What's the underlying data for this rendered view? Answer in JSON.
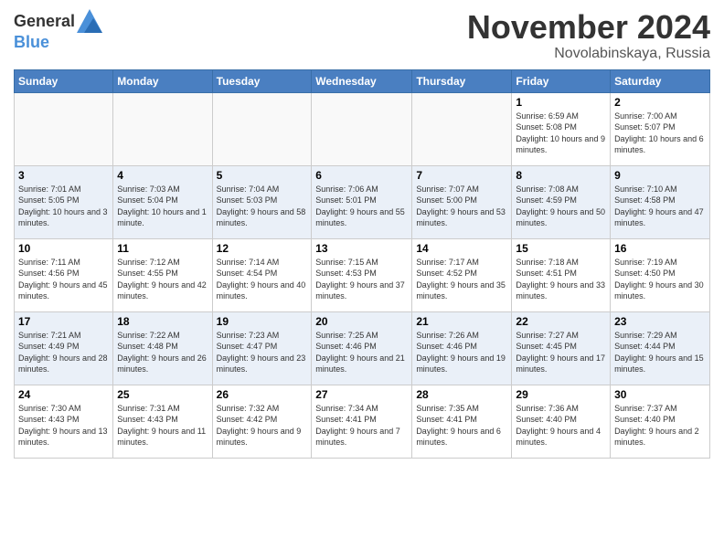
{
  "header": {
    "logo_general": "General",
    "logo_blue": "Blue",
    "month_title": "November 2024",
    "location": "Novolabinskaya, Russia"
  },
  "weekdays": [
    "Sunday",
    "Monday",
    "Tuesday",
    "Wednesday",
    "Thursday",
    "Friday",
    "Saturday"
  ],
  "weeks": [
    [
      {
        "day": "",
        "info": ""
      },
      {
        "day": "",
        "info": ""
      },
      {
        "day": "",
        "info": ""
      },
      {
        "day": "",
        "info": ""
      },
      {
        "day": "",
        "info": ""
      },
      {
        "day": "1",
        "info": "Sunrise: 6:59 AM\nSunset: 5:08 PM\nDaylight: 10 hours\nand 9 minutes."
      },
      {
        "day": "2",
        "info": "Sunrise: 7:00 AM\nSunset: 5:07 PM\nDaylight: 10 hours\nand 6 minutes."
      }
    ],
    [
      {
        "day": "3",
        "info": "Sunrise: 7:01 AM\nSunset: 5:05 PM\nDaylight: 10 hours\nand 3 minutes."
      },
      {
        "day": "4",
        "info": "Sunrise: 7:03 AM\nSunset: 5:04 PM\nDaylight: 10 hours\nand 1 minute."
      },
      {
        "day": "5",
        "info": "Sunrise: 7:04 AM\nSunset: 5:03 PM\nDaylight: 9 hours\nand 58 minutes."
      },
      {
        "day": "6",
        "info": "Sunrise: 7:06 AM\nSunset: 5:01 PM\nDaylight: 9 hours\nand 55 minutes."
      },
      {
        "day": "7",
        "info": "Sunrise: 7:07 AM\nSunset: 5:00 PM\nDaylight: 9 hours\nand 53 minutes."
      },
      {
        "day": "8",
        "info": "Sunrise: 7:08 AM\nSunset: 4:59 PM\nDaylight: 9 hours\nand 50 minutes."
      },
      {
        "day": "9",
        "info": "Sunrise: 7:10 AM\nSunset: 4:58 PM\nDaylight: 9 hours\nand 47 minutes."
      }
    ],
    [
      {
        "day": "10",
        "info": "Sunrise: 7:11 AM\nSunset: 4:56 PM\nDaylight: 9 hours\nand 45 minutes."
      },
      {
        "day": "11",
        "info": "Sunrise: 7:12 AM\nSunset: 4:55 PM\nDaylight: 9 hours\nand 42 minutes."
      },
      {
        "day": "12",
        "info": "Sunrise: 7:14 AM\nSunset: 4:54 PM\nDaylight: 9 hours\nand 40 minutes."
      },
      {
        "day": "13",
        "info": "Sunrise: 7:15 AM\nSunset: 4:53 PM\nDaylight: 9 hours\nand 37 minutes."
      },
      {
        "day": "14",
        "info": "Sunrise: 7:17 AM\nSunset: 4:52 PM\nDaylight: 9 hours\nand 35 minutes."
      },
      {
        "day": "15",
        "info": "Sunrise: 7:18 AM\nSunset: 4:51 PM\nDaylight: 9 hours\nand 33 minutes."
      },
      {
        "day": "16",
        "info": "Sunrise: 7:19 AM\nSunset: 4:50 PM\nDaylight: 9 hours\nand 30 minutes."
      }
    ],
    [
      {
        "day": "17",
        "info": "Sunrise: 7:21 AM\nSunset: 4:49 PM\nDaylight: 9 hours\nand 28 minutes."
      },
      {
        "day": "18",
        "info": "Sunrise: 7:22 AM\nSunset: 4:48 PM\nDaylight: 9 hours\nand 26 minutes."
      },
      {
        "day": "19",
        "info": "Sunrise: 7:23 AM\nSunset: 4:47 PM\nDaylight: 9 hours\nand 23 minutes."
      },
      {
        "day": "20",
        "info": "Sunrise: 7:25 AM\nSunset: 4:46 PM\nDaylight: 9 hours\nand 21 minutes."
      },
      {
        "day": "21",
        "info": "Sunrise: 7:26 AM\nSunset: 4:46 PM\nDaylight: 9 hours\nand 19 minutes."
      },
      {
        "day": "22",
        "info": "Sunrise: 7:27 AM\nSunset: 4:45 PM\nDaylight: 9 hours\nand 17 minutes."
      },
      {
        "day": "23",
        "info": "Sunrise: 7:29 AM\nSunset: 4:44 PM\nDaylight: 9 hours\nand 15 minutes."
      }
    ],
    [
      {
        "day": "24",
        "info": "Sunrise: 7:30 AM\nSunset: 4:43 PM\nDaylight: 9 hours\nand 13 minutes."
      },
      {
        "day": "25",
        "info": "Sunrise: 7:31 AM\nSunset: 4:43 PM\nDaylight: 9 hours\nand 11 minutes."
      },
      {
        "day": "26",
        "info": "Sunrise: 7:32 AM\nSunset: 4:42 PM\nDaylight: 9 hours\nand 9 minutes."
      },
      {
        "day": "27",
        "info": "Sunrise: 7:34 AM\nSunset: 4:41 PM\nDaylight: 9 hours\nand 7 minutes."
      },
      {
        "day": "28",
        "info": "Sunrise: 7:35 AM\nSunset: 4:41 PM\nDaylight: 9 hours\nand 6 minutes."
      },
      {
        "day": "29",
        "info": "Sunrise: 7:36 AM\nSunset: 4:40 PM\nDaylight: 9 hours\nand 4 minutes."
      },
      {
        "day": "30",
        "info": "Sunrise: 7:37 AM\nSunset: 4:40 PM\nDaylight: 9 hours\nand 2 minutes."
      }
    ]
  ]
}
